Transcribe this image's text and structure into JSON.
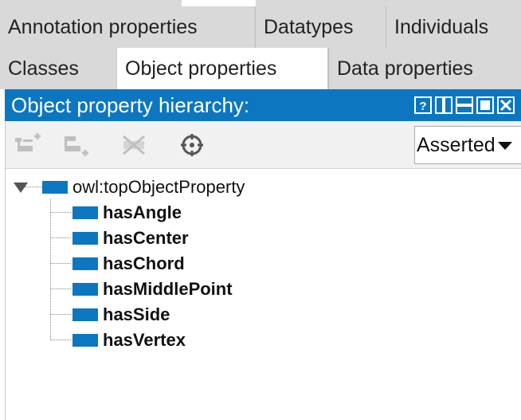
{
  "tabs": {
    "row1": [
      {
        "label": "Annotation properties"
      },
      {
        "label": "Datatypes"
      },
      {
        "label": "Individuals"
      }
    ],
    "row2": [
      {
        "label": "Classes"
      },
      {
        "label": "Object properties"
      },
      {
        "label": "Data properties"
      }
    ]
  },
  "view": {
    "title": "Object property hierarchy:",
    "title_buttons": [
      "help-icon",
      "split-icon",
      "minimize-icon",
      "maximize-icon",
      "close-icon"
    ],
    "accent_color": "#0c77c0"
  },
  "toolbar": {
    "tools": [
      "add-sub-property-icon",
      "add-sibling-property-icon",
      "delete-property-icon",
      "target-icon"
    ],
    "mode_select": {
      "value": "Asserted"
    }
  },
  "tree": {
    "root": {
      "label": "owl:topObjectProperty",
      "expanded": true
    },
    "children": [
      {
        "label": "hasAngle"
      },
      {
        "label": "hasCenter"
      },
      {
        "label": "hasChord"
      },
      {
        "label": "hasMiddlePoint"
      },
      {
        "label": "hasSide"
      },
      {
        "label": "hasVertex"
      }
    ]
  }
}
